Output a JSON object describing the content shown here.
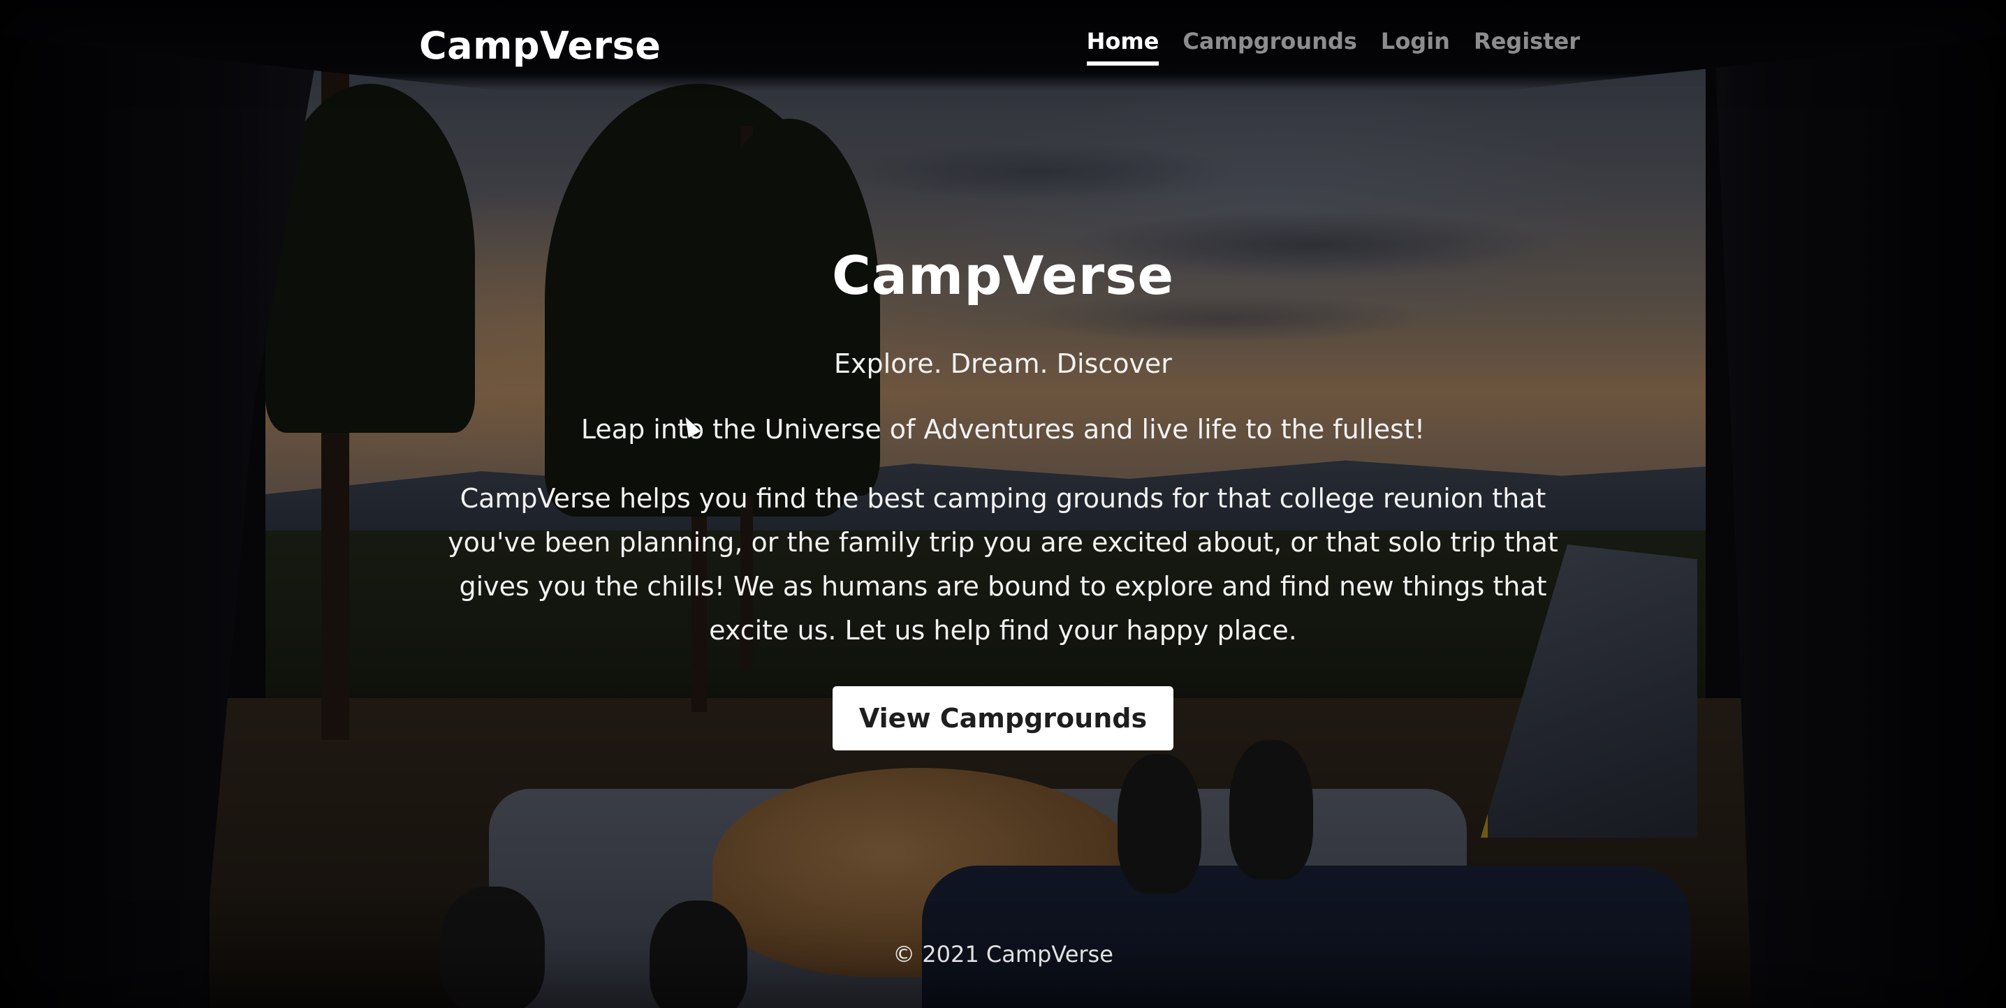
{
  "nav": {
    "brand": "CampVerse",
    "links": [
      {
        "label": "Home",
        "active": true
      },
      {
        "label": "Campgrounds",
        "active": false
      },
      {
        "label": "Login",
        "active": false
      },
      {
        "label": "Register",
        "active": false
      }
    ]
  },
  "hero": {
    "title": "CampVerse",
    "tagline": "Explore. Dream. Discover",
    "lead": "Leap into the Universe of Adventures and live life to the fullest!",
    "description": "CampVerse helps you find the best camping grounds for that college reunion that you've been planning, or the family trip you are excited about, or that solo trip that gives you the chills! We as humans are bound to explore and find new things that excite us. Let us help find your happy place.",
    "cta_label": "View Campgrounds"
  },
  "footer": {
    "text": "© 2021 CampVerse"
  },
  "colors": {
    "text": "#ffffff",
    "nav_inactive": "rgba(255,255,255,0.55)",
    "button_bg": "#ffffff",
    "button_text": "#1e1e1e"
  }
}
